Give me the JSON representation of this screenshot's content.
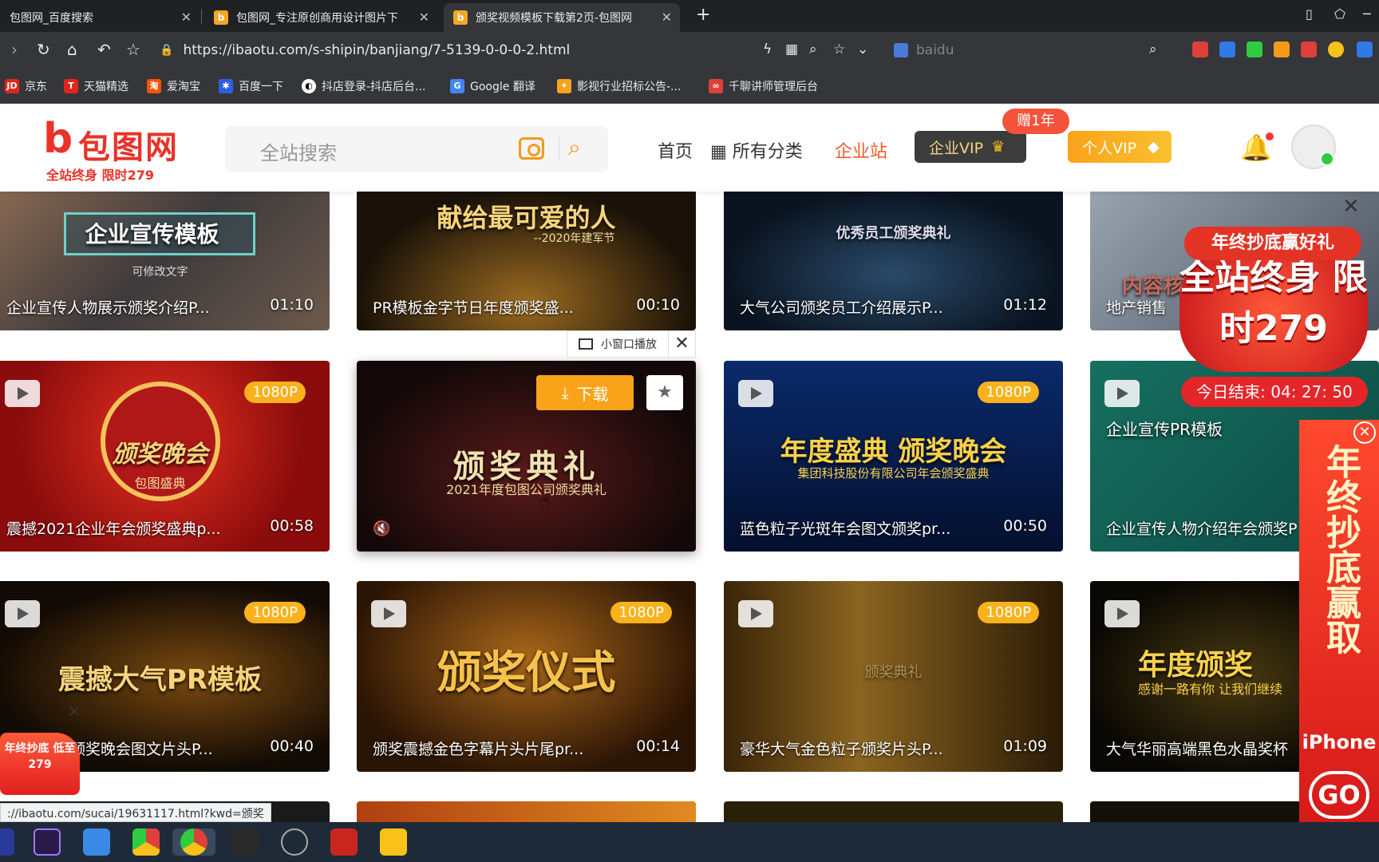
{
  "tabs": [
    {
      "title": "包图网_百度搜索",
      "active": false
    },
    {
      "title": "包图网_专注原创商用设计图片下",
      "active": false
    },
    {
      "title": "颁奖视频模板下载第2页-包图网",
      "active": true
    }
  ],
  "address": {
    "url": "https://ibaotu.com/s-shipin/banjiang/7-5139-0-0-0-2.html",
    "search_placeholder": "baidu"
  },
  "bookmarks": [
    "京东",
    "天猫精选",
    "爱淘宝",
    "百度一下",
    "抖店登录-抖店后台...",
    "Google 翻译",
    "影视行业招标公告-...",
    "千聊讲师管理后台"
  ],
  "site": {
    "logo_name": "包图网",
    "logo_promo": "全站终身 限时279",
    "search_placeholder": "全站搜索",
    "nav": {
      "home": "首页",
      "categories": "所有分类",
      "enterprise": "企业站"
    },
    "vip_enterprise": "企业VIP",
    "vip_gift": "赠1年",
    "vip_personal": "个人VIP"
  },
  "hover": {
    "mini_window": "小窗口播放",
    "download": "下载"
  },
  "cards": [
    {
      "title": "企业宣传人物展示颁奖介绍P...",
      "duration": "01:10",
      "badge": "",
      "art": "企业宣传模板",
      "art_sub": "可修改文字"
    },
    {
      "title": "PR模板金字节日年度颁奖盛...",
      "duration": "00:10",
      "badge": "",
      "art": "献给最可爱的人",
      "art_sub": "--2020年建军节"
    },
    {
      "title": "大气公司颁奖员工介绍展示P...",
      "duration": "01:12",
      "badge": "",
      "art": "优秀员工颁奖典礼",
      "art_sub": ""
    },
    {
      "title": "地产销售",
      "duration": "00",
      "badge": "",
      "art": "内容核",
      "art_sub": ""
    },
    {
      "title": "震撼2021企业年会颁奖盛典p...",
      "duration": "00:58",
      "badge": "1080P",
      "art": "颁奖晚会",
      "art_sub": "包图盛典"
    },
    {
      "title": "",
      "duration": "",
      "badge": "",
      "art": "颁奖典礼",
      "art_sub": "2021年度包图公司颁奖典礼"
    },
    {
      "title": "蓝色粒子光斑年会图文颁奖pr...",
      "duration": "00:50",
      "badge": "1080P",
      "art": "年度盛典 颁奖晚会",
      "art_sub": "集团科技股份有限公司年会颁奖盛典"
    },
    {
      "title": "企业宣传人物介绍年会颁奖P",
      "duration": "",
      "badge": "",
      "art": "企业宣传PR模板",
      "art_sub": ""
    },
    {
      "title": "颁奖晚会图文片头P...",
      "duration": "00:40",
      "badge": "1080P",
      "art": "震撼大气PR模板",
      "art_sub": ""
    },
    {
      "title": "颁奖震撼金色字幕片头片尾pr...",
      "duration": "00:14",
      "badge": "1080P",
      "art": "颁奖仪式",
      "art_sub": ""
    },
    {
      "title": "豪华大气金色粒子颁奖片头P...",
      "duration": "01:09",
      "badge": "1080P",
      "art": "颁奖典礼",
      "art_sub": ""
    },
    {
      "title": "大气华丽高端黑色水晶奖杯",
      "duration": "",
      "badge": "",
      "art": "年度颁奖",
      "art_sub": "感谢一路有你 让我们继续"
    }
  ],
  "ads": {
    "top_banner": "年终抄底赢好礼",
    "main": "全站终身 限时279",
    "timer_label": "今日结束:",
    "timer_value": "04: 27: 50",
    "side_vertical": "年终抄底赢取",
    "side_iphone": "iPhone",
    "side_go": "GO",
    "corner": "年终抄底 低至279"
  },
  "status_url": "://ibaotu.com/sucai/19631117.html?kwd=颁奖",
  "colors": {
    "brand": "#e8332a",
    "accent": "#f9a31b",
    "vip_gold": "#f3d18a",
    "chrome_dark": "#35363a"
  }
}
